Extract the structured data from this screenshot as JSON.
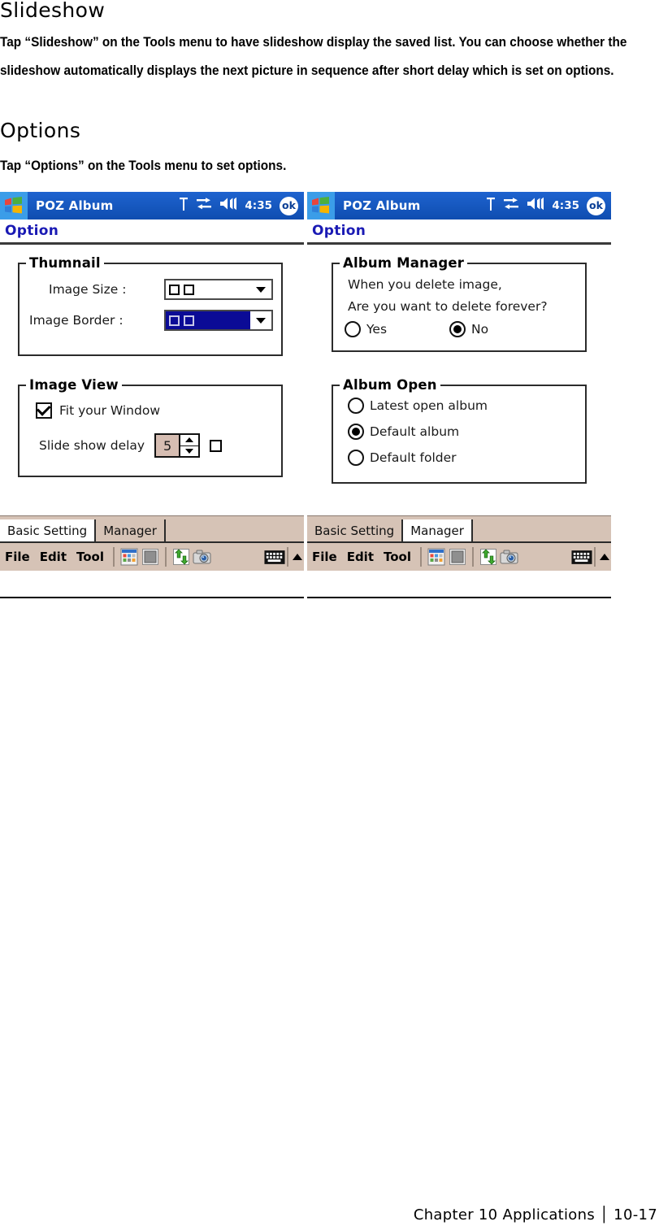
{
  "document": {
    "heading1": "Slideshow",
    "para1_line1": "Tap “Slideshow” on the Tools menu to have slideshow display the saved list. You can choose whether the",
    "para1_line2": "slideshow automatically displays the next picture in sequence after short delay which is set on options.",
    "heading2": "Options",
    "para2": "Tap “Options” on the Tools menu to set options.",
    "footer": "Chapter 10 Applications  │  10-17"
  },
  "colors": {
    "titlebar_blue": "#1a5dc8",
    "start_tile_blue": "#3b9de8",
    "caption_text_blue": "#1a1ab4",
    "selected_combo_navy": "#0b0b96",
    "toolbar_tan": "#d6c3b6",
    "spinner_field": "#d6bdb2"
  },
  "screens": [
    {
      "id": "basic-setting",
      "titlebar": {
        "start_icon": "windows-flag-icon",
        "app_title": "POZ Album",
        "antenna_icon": "antenna-icon",
        "network_icon": "network-connection-icon",
        "volume_icon": "volume-speaker-icon",
        "time": "4:35",
        "ok_label": "ok"
      },
      "caption": "Option",
      "groups": [
        {
          "title": "Thumnail",
          "fields": [
            {
              "label": "Image Size :",
              "type": "combo",
              "value": "□□",
              "selected": false
            },
            {
              "label": "Image Border :",
              "type": "combo",
              "value": "□□",
              "selected": true
            }
          ]
        },
        {
          "title": "Image View",
          "fields": [
            {
              "label": "Fit your Window",
              "type": "checkbox",
              "checked": true
            },
            {
              "label": "Slide show delay",
              "type": "spinner",
              "value": "5",
              "trailing": "□"
            }
          ]
        }
      ],
      "tabs": [
        {
          "label": "Basic Setting",
          "active": true
        },
        {
          "label": "Manager",
          "active": false
        }
      ],
      "commandbar": {
        "menus": [
          "File",
          "Edit",
          "Tool"
        ],
        "buttons": [
          "thumbnail-grid-icon",
          "single-image-icon",
          "sync-arrows-icon",
          "camera-icon"
        ],
        "sip": "keyboard-icon",
        "sip_arrow": "chevron-up-icon"
      }
    },
    {
      "id": "manager",
      "titlebar": {
        "start_icon": "windows-flag-icon",
        "app_title": "POZ Album",
        "antenna_icon": "antenna-icon",
        "network_icon": "network-connection-icon",
        "volume_icon": "volume-speaker-icon",
        "time": "4:35",
        "ok_label": "ok"
      },
      "caption": "Option",
      "groups": [
        {
          "title": "Album Manager",
          "text_lines": [
            "When you delete image,",
            "Are you want to delete forever?"
          ],
          "radios": [
            {
              "label": "Yes",
              "selected": false
            },
            {
              "label": "No",
              "selected": true
            }
          ]
        },
        {
          "title": "Album Open",
          "radios": [
            {
              "label": "Latest open album",
              "selected": false
            },
            {
              "label": "Default album",
              "selected": true
            },
            {
              "label": "Default folder",
              "selected": false
            }
          ]
        }
      ],
      "tabs": [
        {
          "label": "Basic Setting",
          "active": false
        },
        {
          "label": "Manager",
          "active": true
        }
      ],
      "commandbar": {
        "menus": [
          "File",
          "Edit",
          "Tool"
        ],
        "buttons": [
          "thumbnail-grid-icon",
          "single-image-icon",
          "sync-arrows-icon",
          "camera-icon"
        ],
        "sip": "keyboard-icon",
        "sip_arrow": "chevron-up-icon"
      }
    }
  ]
}
